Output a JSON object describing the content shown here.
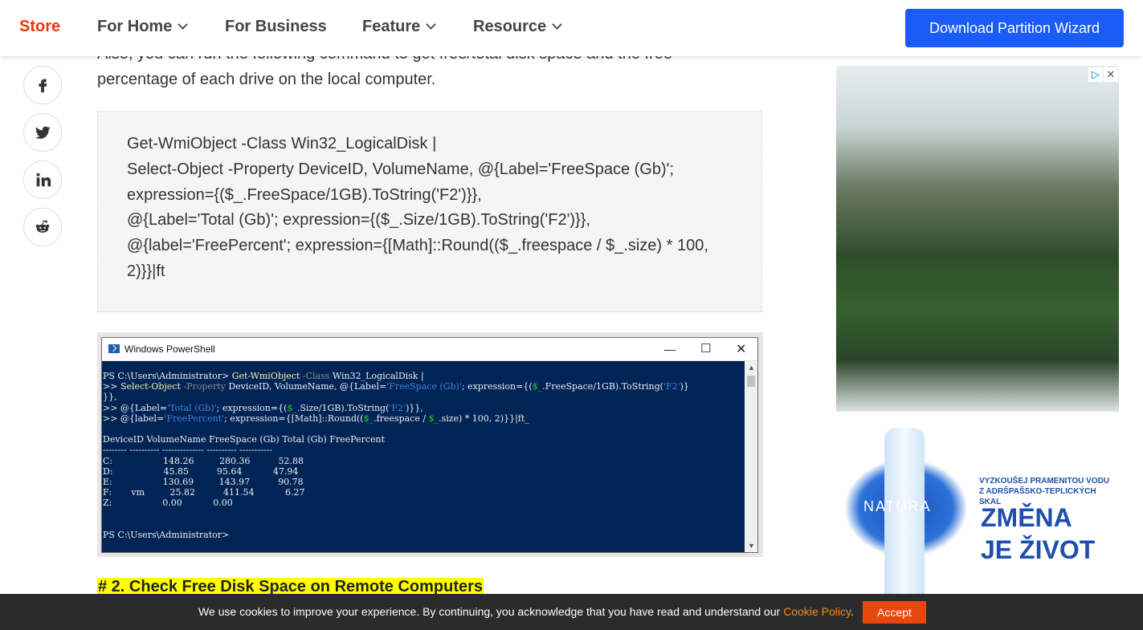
{
  "nav": {
    "store": "Store",
    "for_home": "For Home",
    "for_business": "For Business",
    "feature": "Feature",
    "resource": "Resource",
    "download": "Download Partition Wizard"
  },
  "social": [
    "facebook-icon",
    "twitter-icon",
    "linkedin-icon",
    "reddit-icon"
  ],
  "article": {
    "intro_line1": "Also, you can run the following command to get free/total disk space and the free",
    "intro_line2": "percentage of each drive on the local computer.",
    "code_lines": [
      "Get-WmiObject -Class Win32_LogicalDisk |",
      "Select-Object -Property DeviceID, VolumeName, @{Label='FreeSpace (Gb)';",
      "expression={($_.FreeSpace/1GB).ToString('F2')}},",
      "@{Label='Total (Gb)'; expression={($_.Size/1GB).ToString('F2')}},",
      "@{label='FreePercent'; expression={[Math]::Round(($_.freespace / $_.size) * 100,",
      "2)}}|ft"
    ],
    "heading": "# 2. Check Free Disk Space on Remote Computers"
  },
  "powershell": {
    "title": "Windows PowerShell",
    "prompt1": "PS C:\\Users\\Administrator> ",
    "table_header": "DeviceID VolumeName FreeSpace (Gb) Total (Gb) FreePercent",
    "table_rule": "-------- ---------- -------------- ---------- -----------",
    "rows": [
      "C:                  148.26         280.36          52.88",
      "D:                  45.85          95.64           47.94",
      "E:                  130.69         143.97          90.78",
      "F:       vm         25.82          411.54           6.27",
      "Z:                  0.00           0.00"
    ],
    "prompt2": "PS C:\\Users\\Administrator>"
  },
  "ad": {
    "brand": "NATURA",
    "small_line1": "VYZKOUŠEJ PRAMENITOU VODU",
    "small_line2": "Z ADRŠPAŠSKO-TEPLICKÝCH SKAL",
    "big_line1": "ZMĚNA",
    "big_line2": "JE ŽIVOT"
  },
  "cookie": {
    "text": "We use cookies to improve your experience. By continuing, you acknowledge that you have read and understand our ",
    "link": "Cookie Policy",
    "period": ".",
    "accept": "Accept"
  },
  "colors": {
    "accent": "#e8380d",
    "button_blue": "#1a5cf5",
    "console_bg": "#012456",
    "highlight": "#ffff00"
  }
}
